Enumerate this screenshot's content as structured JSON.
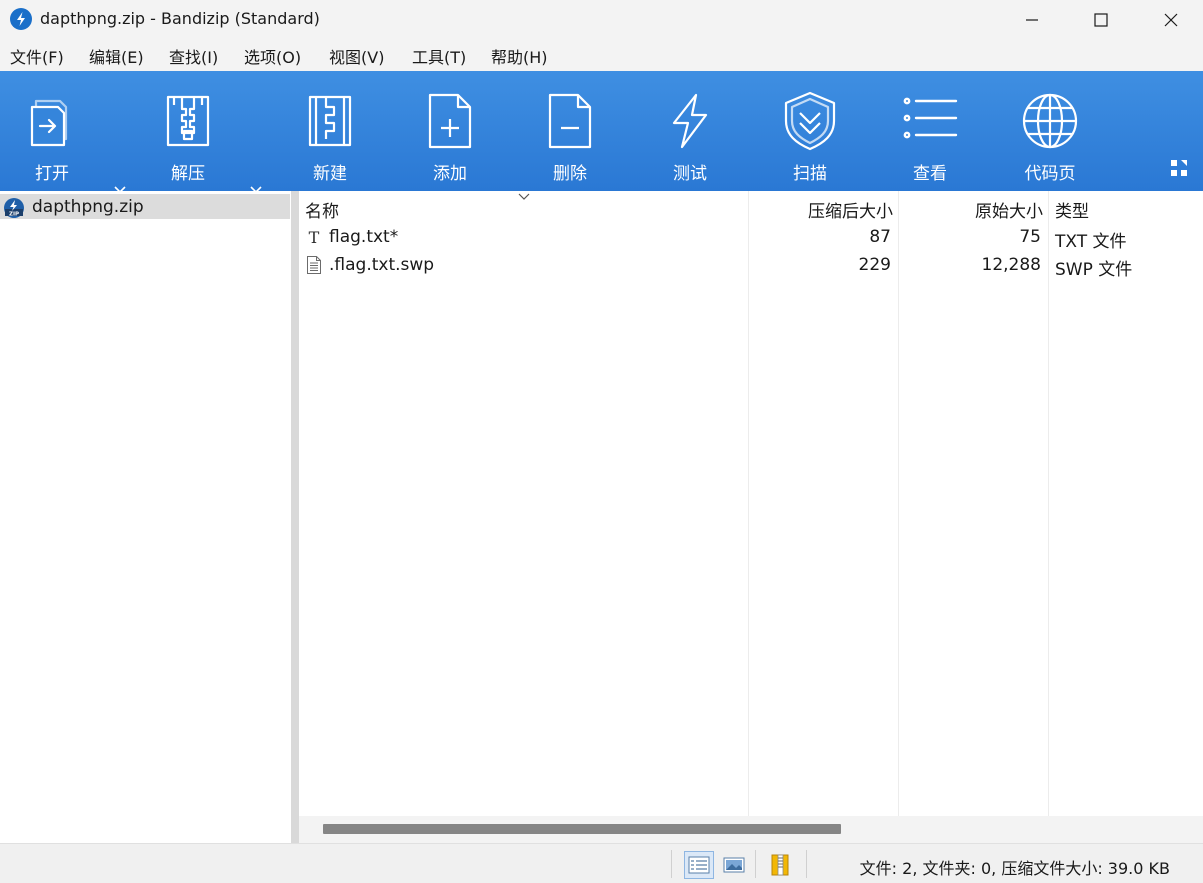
{
  "window": {
    "title": "dapthpng.zip - Bandizip (Standard)",
    "accent_color": "#2f80d8"
  },
  "menu": {
    "items": [
      {
        "label": "文件(F)"
      },
      {
        "label": "编辑(E)"
      },
      {
        "label": "查找(I)"
      },
      {
        "label": "选项(O)"
      },
      {
        "label": "视图(V)"
      },
      {
        "label": "工具(T)"
      },
      {
        "label": "帮助(H)"
      }
    ]
  },
  "toolbar": {
    "buttons": [
      {
        "label": "打开",
        "icon": "open-icon"
      },
      {
        "label": "解压",
        "icon": "extract-icon"
      },
      {
        "label": "新建",
        "icon": "new-archive-icon"
      },
      {
        "label": "添加",
        "icon": "add-file-icon"
      },
      {
        "label": "删除",
        "icon": "delete-file-icon"
      },
      {
        "label": "测试",
        "icon": "lightning-icon"
      },
      {
        "label": "扫描",
        "icon": "shield-icon"
      },
      {
        "label": "查看",
        "icon": "list-view-icon"
      },
      {
        "label": "代码页",
        "icon": "globe-icon"
      }
    ]
  },
  "tree": {
    "items": [
      {
        "label": "dapthpng.zip",
        "selected": true
      }
    ]
  },
  "filelist": {
    "columns": {
      "name": "名称",
      "compressed": "压缩后大小",
      "original": "原始大小",
      "type": "类型"
    },
    "rows": [
      {
        "name": "flag.txt*",
        "compressed": "87",
        "original": "75",
        "type": "TXT 文件",
        "icon": "text-file-icon"
      },
      {
        "name": ".flag.txt.swp",
        "compressed": "229",
        "original": "12,288",
        "type": "SWP 文件",
        "icon": "document-icon"
      }
    ]
  },
  "status": {
    "text": "文件: 2, 文件夹: 0, 压缩文件大小: 39.0 KB"
  }
}
